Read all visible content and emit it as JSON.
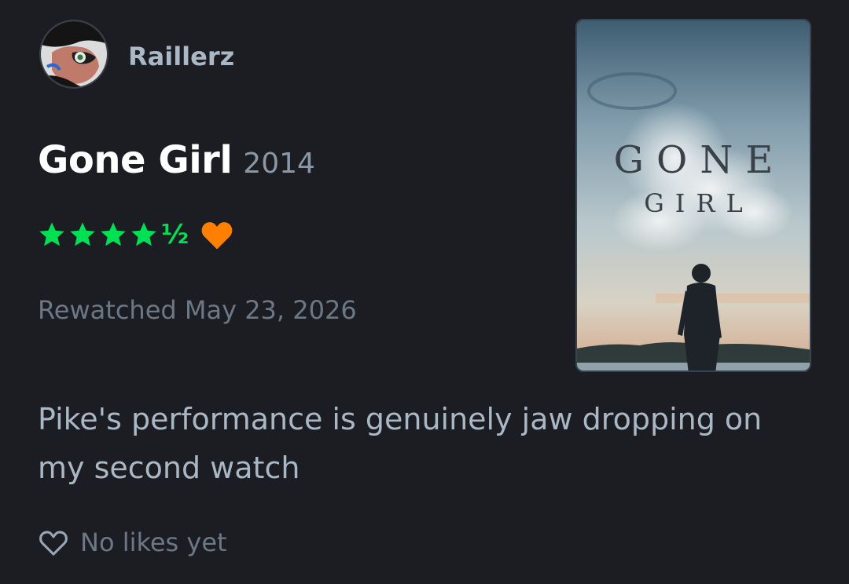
{
  "review": {
    "username": "Raillerz",
    "film": {
      "title": "Gone Girl",
      "year": "2014"
    },
    "rating": {
      "stars": 4.5,
      "half_glyph": "½",
      "liked": true
    },
    "watch_label": "Rewatched May 23, 2026",
    "text": "Pike's performance is genuinely jaw dropping on my second watch",
    "likes_label": "No likes yet",
    "poster": {
      "line1": "GONE",
      "line2": "GIRL"
    }
  },
  "colors": {
    "background": "#1b1d22",
    "star": "#00e054",
    "heart": "#ff8000",
    "username": "#aab7c4",
    "muted": "#6c7886"
  },
  "icons": {
    "avatar": "avatar-image",
    "star": "star-icon",
    "like_heart": "heart-filled-icon",
    "likes": "heart-outline-icon"
  }
}
